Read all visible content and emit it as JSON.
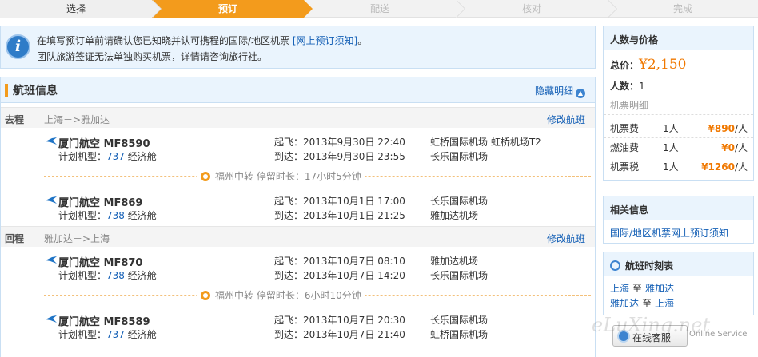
{
  "steps": [
    {
      "label": "选择",
      "state": "done"
    },
    {
      "label": "预订",
      "state": "active"
    },
    {
      "label": "配送",
      "state": "todo"
    },
    {
      "label": "核对",
      "state": "todo"
    },
    {
      "label": "完成",
      "state": "todo"
    }
  ],
  "notice": {
    "line1": "在填写预订单前请确认您已知晓并认可携程的国际/地区机票",
    "link": "[网上预订须知]",
    "line1_end": "。",
    "line2": "团队旅游签证无法单独购买机票，详情请咨询旅行社。"
  },
  "flight_panel": {
    "title": "航班信息",
    "toggle": "隐藏明细"
  },
  "outbound": {
    "dir": "去程",
    "route": "上海－>雅加达",
    "modify": "修改航班",
    "flights": [
      {
        "airline": "厦门航空 MF8590",
        "model_label": "计划机型：",
        "model": "737",
        "cabin": "经济舱",
        "dep": "起飞：2013年9月30日 22:40",
        "dep_airport": "虹桥国际机场 虹桥机场T2",
        "arr": "到达：2013年9月30日 23:55",
        "arr_airport": "长乐国际机场"
      },
      {
        "airline": "厦门航空 MF869",
        "model_label": "计划机型：",
        "model": "738",
        "cabin": "经济舱",
        "dep": "起飞：2013年10月1日 17:00",
        "dep_airport": "长乐国际机场",
        "arr": "到达：2013年10月1日 21:25",
        "arr_airport": "雅加达机场"
      }
    ],
    "transfer": "福州中转 停留时长：17小时5分钟"
  },
  "return": {
    "dir": "回程",
    "route": "雅加达－>上海",
    "modify": "修改航班",
    "flights": [
      {
        "airline": "厦门航空 MF870",
        "model_label": "计划机型：",
        "model": "738",
        "cabin": "经济舱",
        "dep": "起飞：2013年10月7日 08:10",
        "dep_airport": "雅加达机场",
        "arr": "到达：2013年10月7日 14:20",
        "arr_airport": "长乐国际机场"
      },
      {
        "airline": "厦门航空 MF8589",
        "model_label": "计划机型：",
        "model": "737",
        "cabin": "经济舱",
        "dep": "起飞：2013年10月7日 20:30",
        "dep_airport": "长乐国际机场",
        "arr": "到达：2013年10月7日 21:40",
        "arr_airport": "虹桥国际机场"
      }
    ],
    "transfer": "福州中转 停留时长：6小时10分钟"
  },
  "price": {
    "title": "人数与价格",
    "total_label": "总价：",
    "total": "¥2,150",
    "people_label": "人数：",
    "people": "1",
    "detail_label": "机票明细",
    "fees": [
      {
        "name": "机票费",
        "count": "1人",
        "value": "¥890",
        "unit": "/人"
      },
      {
        "name": "燃油费",
        "count": "1人",
        "value": "¥0",
        "unit": "/人"
      },
      {
        "name": "机票税",
        "count": "1人",
        "value": "¥1260",
        "unit": "/人"
      }
    ]
  },
  "related": {
    "title": "相关信息",
    "link": "国际/地区机票网上预订须知"
  },
  "schedule": {
    "title": "航班时刻表",
    "rows": [
      {
        "from": "上海",
        "to_word": "至",
        "to": "雅加达"
      },
      {
        "from": "雅加达",
        "to_word": "至",
        "to": "上海"
      }
    ]
  },
  "service": {
    "label": "在线客服",
    "en": "Online Service"
  },
  "watermark": "eLuXing.net",
  "colors": {
    "accent": "#f39b1c",
    "link": "#1560b6",
    "price": "#f07800",
    "panel_bg": "#eaf4fd"
  }
}
